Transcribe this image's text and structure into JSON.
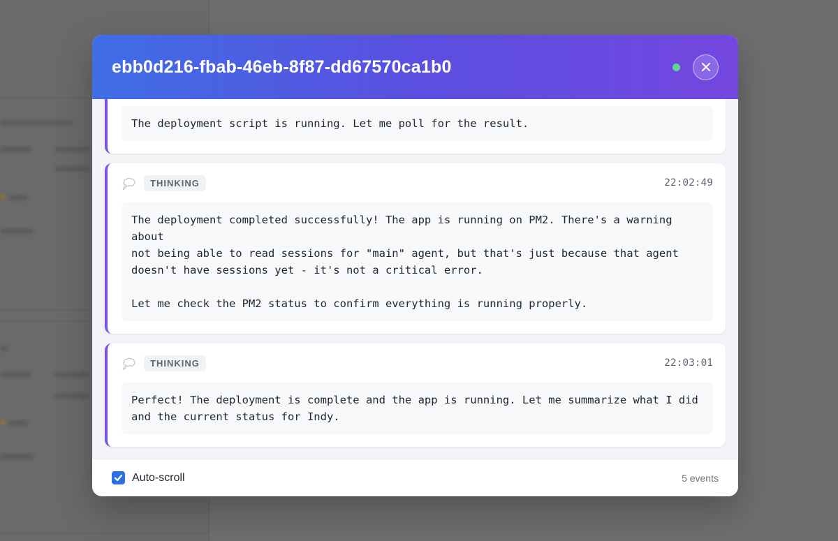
{
  "modal": {
    "title": "ebb0d216-fbab-46eb-8f87-dd67570ca1b0",
    "status_color": "#5fd68e",
    "close_icon": "close-icon"
  },
  "events": [
    {
      "text": "The deployment script is running. Let me poll for the result."
    },
    {
      "badge": "THINKING",
      "icon": "thought-bubble-icon",
      "timestamp": "22:02:49",
      "text": "The deployment completed successfully! The app is running on PM2. There's a warning about\nnot being able to read sessions for \"main\" agent, but that's just because that agent\ndoesn't have sessions yet - it's not a critical error.\n\nLet me check the PM2 status to confirm everything is running properly."
    },
    {
      "badge": "THINKING",
      "icon": "thought-bubble-icon",
      "timestamp": "22:03:01",
      "text": "Perfect! The deployment is complete and the app is running. Let me summarize what I did\nand the current status for Indy."
    }
  ],
  "footer": {
    "auto_scroll_label": "Auto-scroll",
    "auto_scroll_checked": true,
    "event_count": "5 events"
  },
  "colors": {
    "accent": "#7a55e0",
    "header_gradient_start": "#3f6ee6",
    "header_gradient_end": "#7446e0",
    "checkbox": "#2f6fe6"
  }
}
